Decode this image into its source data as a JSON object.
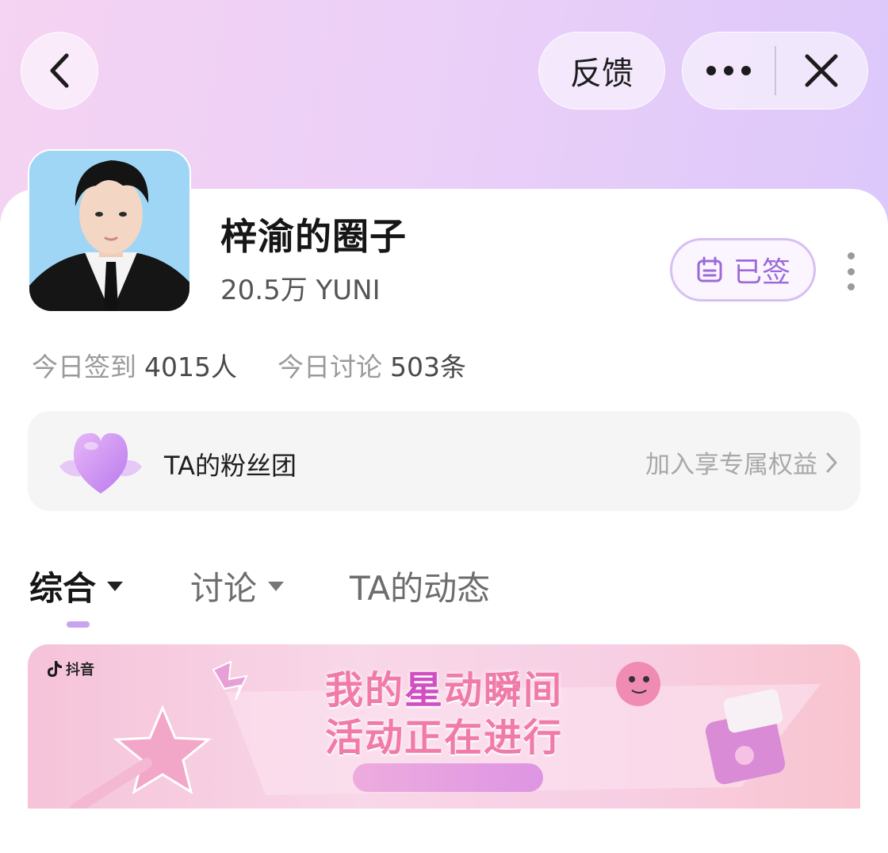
{
  "header": {
    "back_icon": "chevron-left-icon",
    "feedback_label": "反馈",
    "more_icon": "more-horizontal-icon",
    "close_icon": "close-icon"
  },
  "profile": {
    "title": "梓渝的圈子",
    "subtitle": "20.5万 YUNI",
    "signed_label": "已签",
    "signed_icon": "calendar-icon",
    "more_icon": "more-vertical-icon"
  },
  "stats": {
    "checkin_label": "今日签到",
    "checkin_value": "4015人",
    "discussion_label": "今日讨论",
    "discussion_value": "503条"
  },
  "fan_club": {
    "label": "TA的粉丝团",
    "cta": "加入享专属权益",
    "icon": "heart-icon"
  },
  "tabs": [
    {
      "label": "综合",
      "active": true,
      "has_dropdown": true
    },
    {
      "label": "讨论",
      "active": false,
      "has_dropdown": true
    },
    {
      "label": "TA的动态",
      "active": false,
      "has_dropdown": false
    }
  ],
  "banner": {
    "logo_text": "抖音",
    "line1_prefix": "我的",
    "line1_star": "星",
    "line1_suffix": "动瞬间",
    "line2": "活动正在进行"
  },
  "colors": {
    "accent": "#c8a4ee",
    "signed_text": "#9c6ad8",
    "banner_text": "#f07aa8"
  }
}
